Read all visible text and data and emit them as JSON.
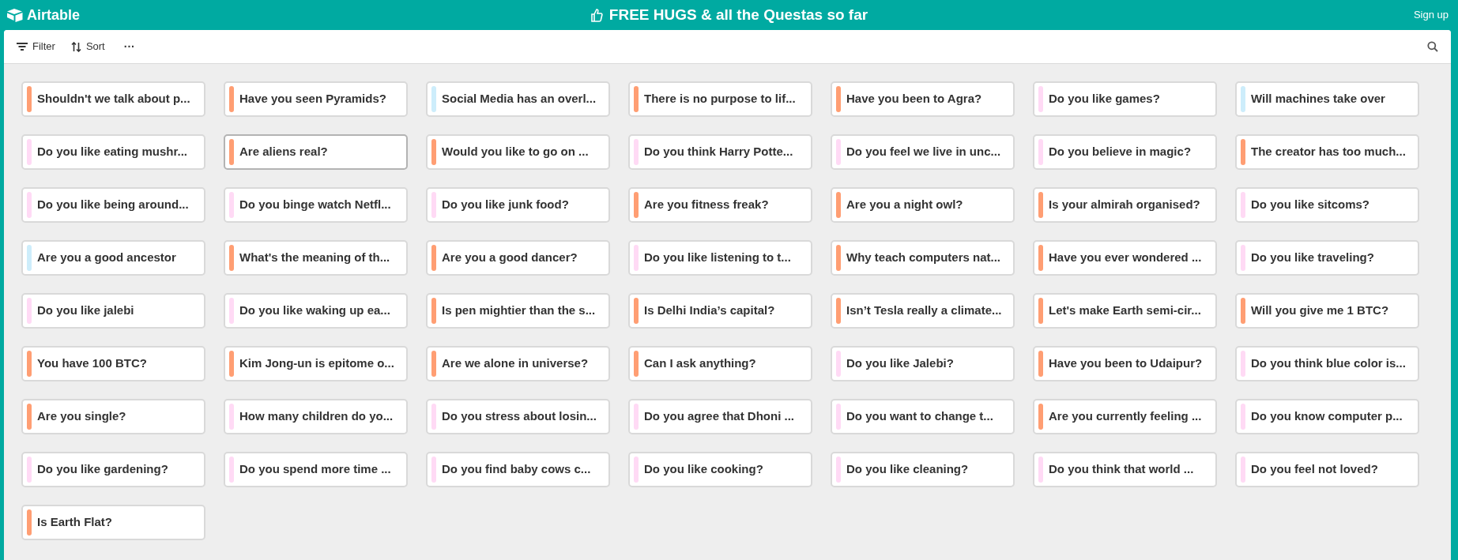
{
  "header": {
    "logo": "Airtable",
    "title": "FREE HUGS & all the Questas so far",
    "sign_up": "Sign up"
  },
  "toolbar": {
    "filter": "Filter",
    "sort": "Sort",
    "more": "···"
  },
  "cards": [
    {
      "title": "Shouldn't we talk about p...",
      "color": "#ff9e73",
      "selected": false
    },
    {
      "title": "Have you seen Pyramids?",
      "color": "#ff9e73",
      "selected": false
    },
    {
      "title": "Social Media has an overl...",
      "color": "#cdedfb",
      "selected": false
    },
    {
      "title": "There is no purpose to lif...",
      "color": "#ff9e73",
      "selected": false
    },
    {
      "title": "Have you been to Agra?",
      "color": "#ff9e73",
      "selected": false
    },
    {
      "title": "Do you like games?",
      "color": "#ffdaf5",
      "selected": false
    },
    {
      "title": "Will machines take over",
      "color": "#cdedfb",
      "selected": false
    },
    {
      "title": "Do you like eating mushr...",
      "color": "#ffdaf5",
      "selected": false
    },
    {
      "title": "Are aliens real?",
      "color": "#ff9e73",
      "selected": true
    },
    {
      "title": "Would you like to go on ...",
      "color": "#ff9e73",
      "selected": false
    },
    {
      "title": "Do you think Harry Potte...",
      "color": "#ffdaf5",
      "selected": false
    },
    {
      "title": "Do you feel we live in unc...",
      "color": "#ffdaf5",
      "selected": false
    },
    {
      "title": "Do you believe in magic?",
      "color": "#ffdaf5",
      "selected": false
    },
    {
      "title": "The creator has too much...",
      "color": "#ff9e73",
      "selected": false
    },
    {
      "title": "Do you like being around...",
      "color": "#ffdaf5",
      "selected": false
    },
    {
      "title": "Do you binge watch Netfl...",
      "color": "#ffdaf5",
      "selected": false
    },
    {
      "title": "Do you like junk food?",
      "color": "#ffdaf5",
      "selected": false
    },
    {
      "title": "Are you fitness freak?",
      "color": "#ff9e73",
      "selected": false
    },
    {
      "title": "Are you a night owl?",
      "color": "#ff9e73",
      "selected": false
    },
    {
      "title": "Is your almirah organised?",
      "color": "#ff9e73",
      "selected": false
    },
    {
      "title": "Do you like sitcoms?",
      "color": "#ffdaf5",
      "selected": false
    },
    {
      "title": "Are you a good ancestor",
      "color": "#cdedfb",
      "selected": false
    },
    {
      "title": "What's the meaning of th...",
      "color": "#ff9e73",
      "selected": false
    },
    {
      "title": "Are you a good dancer?",
      "color": "#ff9e73",
      "selected": false
    },
    {
      "title": "Do you like listening to t...",
      "color": "#ffdaf5",
      "selected": false
    },
    {
      "title": "Why teach computers nat...",
      "color": "#ff9e73",
      "selected": false
    },
    {
      "title": "Have you ever wondered ...",
      "color": "#ff9e73",
      "selected": false
    },
    {
      "title": "Do you like traveling?",
      "color": "#ffdaf5",
      "selected": false
    },
    {
      "title": "Do you like jalebi",
      "color": "#ffdaf5",
      "selected": false
    },
    {
      "title": "Do you like waking up ea...",
      "color": "#ffdaf5",
      "selected": false
    },
    {
      "title": "Is pen mightier than the s...",
      "color": "#ff9e73",
      "selected": false
    },
    {
      "title": "Is Delhi India’s capital?",
      "color": "#ff9e73",
      "selected": false
    },
    {
      "title": "Isn’t Tesla really a climate...",
      "color": "#ff9e73",
      "selected": false
    },
    {
      "title": "Let's make Earth semi-cir...",
      "color": "#ff9e73",
      "selected": false
    },
    {
      "title": "Will you give me 1 BTC?",
      "color": "#ff9e73",
      "selected": false
    },
    {
      "title": "You have 100 BTC?",
      "color": "#ff9e73",
      "selected": false
    },
    {
      "title": "Kim Jong-un is epitome o...",
      "color": "#ff9e73",
      "selected": false
    },
    {
      "title": "Are we alone in universe?",
      "color": "#ff9e73",
      "selected": false
    },
    {
      "title": "Can I ask anything?",
      "color": "#ff9e73",
      "selected": false
    },
    {
      "title": "Do you like Jalebi?",
      "color": "#ffdaf5",
      "selected": false
    },
    {
      "title": "Have you been to Udaipur?",
      "color": "#ff9e73",
      "selected": false
    },
    {
      "title": "Do you think blue color is...",
      "color": "#ffdaf5",
      "selected": false
    },
    {
      "title": "Are you single?",
      "color": "#ff9e73",
      "selected": false
    },
    {
      "title": "How many children do yo...",
      "color": "#ffdaf5",
      "selected": false
    },
    {
      "title": "Do you stress about losin...",
      "color": "#ffdaf5",
      "selected": false
    },
    {
      "title": "Do you agree that Dhoni ...",
      "color": "#ffdaf5",
      "selected": false
    },
    {
      "title": "Do you want to change t...",
      "color": "#ffdaf5",
      "selected": false
    },
    {
      "title": "Are you currently feeling ...",
      "color": "#ff9e73",
      "selected": false
    },
    {
      "title": "Do you know computer p...",
      "color": "#ffdaf5",
      "selected": false
    },
    {
      "title": "Do you like gardening?",
      "color": "#ffdaf5",
      "selected": false
    },
    {
      "title": "Do you spend more time ...",
      "color": "#ffdaf5",
      "selected": false
    },
    {
      "title": "Do you find baby cows c...",
      "color": "#ffdaf5",
      "selected": false
    },
    {
      "title": "Do you like cooking?",
      "color": "#ffdaf5",
      "selected": false
    },
    {
      "title": "Do you like cleaning?",
      "color": "#ffdaf5",
      "selected": false
    },
    {
      "title": "Do you think that world ...",
      "color": "#ffdaf5",
      "selected": false
    },
    {
      "title": "Do you feel not loved?",
      "color": "#ffdaf5",
      "selected": false
    },
    {
      "title": "Is Earth Flat?",
      "color": "#ff9e73",
      "selected": false
    }
  ]
}
